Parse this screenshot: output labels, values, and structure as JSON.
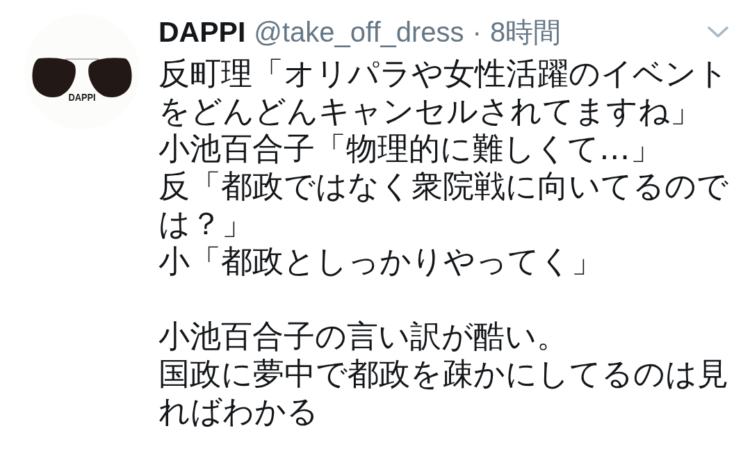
{
  "tweet": {
    "avatar": {
      "logo_text": "DAPPI"
    },
    "author": {
      "name": "DAPPI",
      "handle": "@take_off_dress"
    },
    "separator": "·",
    "time": "8時間",
    "paragraphs": [
      {
        "lines": [
          "反町理「オリパラや女性活躍のイベント",
          "をどんどんキャンセルされてますね」",
          "小池百合子「物理的に難しくて…」",
          "反「都政ではなく衆院戦に向いてるので",
          "は？」",
          "小「都政としっかりやってく」"
        ]
      },
      {
        "lines": [
          "小池百合子の言い訳が酷い。",
          "国政に夢中で都政を疎かにしてるのは見",
          "ればわかる"
        ]
      }
    ]
  }
}
